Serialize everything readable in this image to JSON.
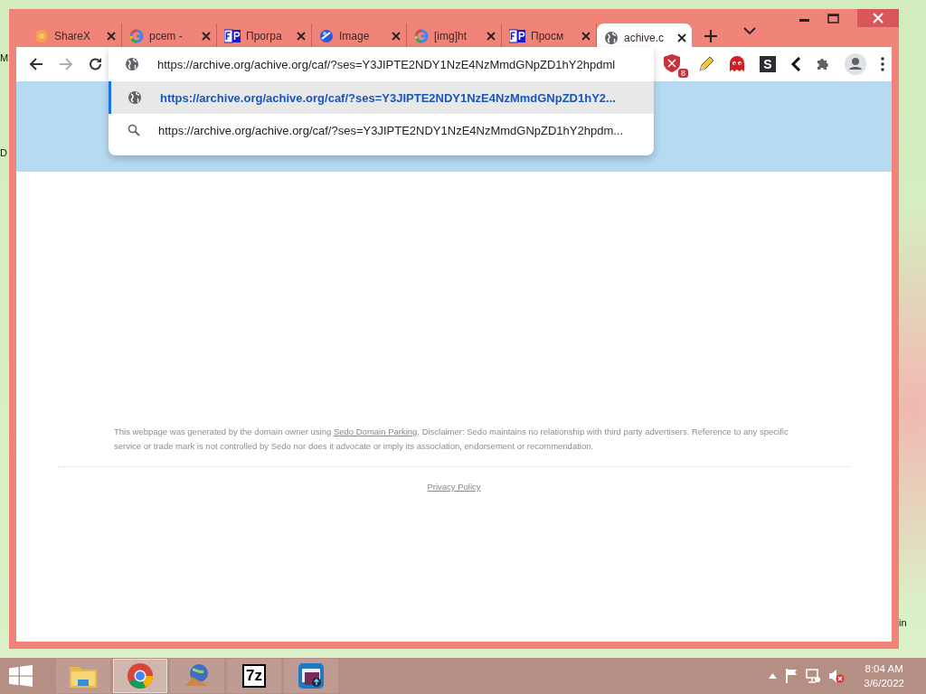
{
  "desktop": {
    "edge_labels": [
      "M",
      "D",
      "in"
    ]
  },
  "browser": {
    "tabs": [
      {
        "title": "ShareX",
        "kind": "sharex",
        "selected": false
      },
      {
        "title": "pcem -",
        "kind": "google",
        "selected": false
      },
      {
        "title": "Програ",
        "kind": "fp",
        "selected": false
      },
      {
        "title": "Image",
        "kind": "sphere",
        "selected": false
      },
      {
        "title": "[img]ht",
        "kind": "google",
        "selected": false
      },
      {
        "title": "Просм",
        "kind": "fp",
        "selected": false
      },
      {
        "title": "achive.c",
        "kind": "globe",
        "selected": true
      }
    ],
    "nav": [
      {
        "kind": "back",
        "disabled": false
      },
      {
        "kind": "forward",
        "disabled": true
      },
      {
        "kind": "reload",
        "disabled": false
      }
    ],
    "address": {
      "value": "https://archive.org/achive.org/caf/?ses=Y3JIPTE2NDY1NzE4NzMmdGNpZD1hY2hpdml"
    },
    "suggestions": [
      {
        "text": "https://archive.org/achive.org/caf/?ses=Y3JIPTE2NDY1NzE4NzMmdGNpZD1hY2...",
        "kind": "url",
        "selected": true
      },
      {
        "text": "https://archive.org/achive.org/caf/?ses=Y3JIPTE2NDY1NzE4NzMmdGNpZD1hY2hpdm...",
        "kind": "search",
        "selected": false
      }
    ],
    "extensions": [
      {
        "kind": "shield",
        "badge": "8"
      },
      {
        "kind": "pencil"
      },
      {
        "kind": "ghost"
      },
      {
        "kind": "letter",
        "label": "S"
      },
      {
        "kind": "chevron"
      },
      {
        "kind": "puzzle"
      },
      {
        "kind": "profile"
      },
      {
        "kind": "menu"
      }
    ]
  },
  "page": {
    "disclaimer": {
      "before": "This webpage was generated by the domain owner using ",
      "link": "Sedo Domain Parking",
      "after": ". Disclaimer: Sedo maintains no relationship with third party advertisers. Reference to any specific service or trade mark is not controlled by Sedo nor does it advocate or imply its association, endorsement or recommendation."
    },
    "privacy_link": "Privacy Policy"
  },
  "taskbar": {
    "apps": [
      {
        "kind": "folder",
        "selected": false
      },
      {
        "kind": "chrome",
        "selected": true
      },
      {
        "kind": "globe",
        "selected": false
      },
      {
        "kind": "sevenzip",
        "label": "7z",
        "selected": false
      },
      {
        "kind": "window",
        "selected": false
      }
    ],
    "clock": {
      "time": "8:04 AM",
      "date": "3/6/2022"
    }
  }
}
